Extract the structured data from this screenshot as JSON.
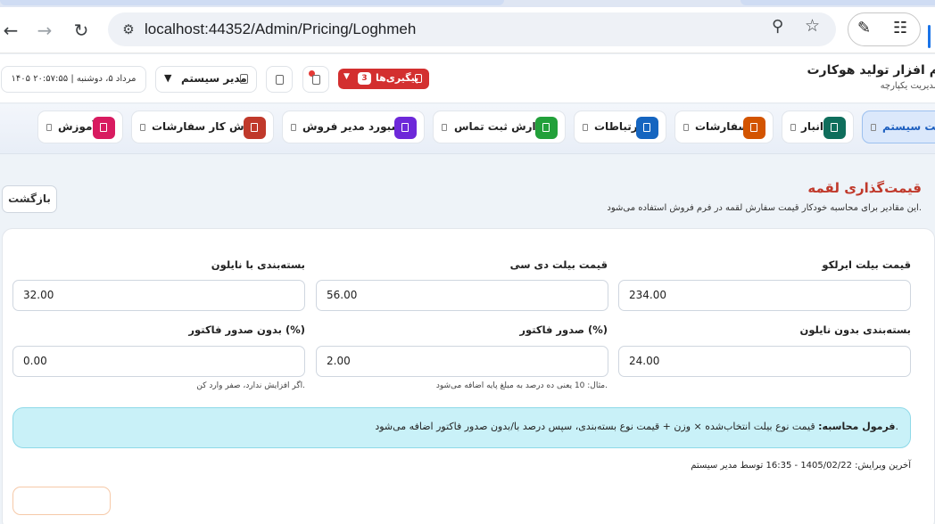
{
  "browser": {
    "url": "localhost:44352/Admin/Pricing/Loghmeh"
  },
  "header": {
    "brand_title": "م افزار تولید هوکارت",
    "brand_subtitle": "مدیریت یکپارچه",
    "datetime": "۱۴۰۵ مرداد ۵، دوشنبه   |   ۲۰:۵۷:۵۵",
    "user_name": "مدیر سیستم",
    "followups_label": "پیگیری‌ها",
    "followups_count": "3",
    "colors": {
      "followups": "#d32f2f"
    }
  },
  "modules": [
    {
      "label": "ریت سیستم",
      "color": "#1d5fbf",
      "active": true
    },
    {
      "label": "انبار",
      "color": "#0f6e5c"
    },
    {
      "label": "سفارشات",
      "color": "#d35400"
    },
    {
      "label": "ارتباطات",
      "color": "#1565c0"
    },
    {
      "label": "گزارش ثبت تماس",
      "color": "#22a03a"
    },
    {
      "label": "داشبورد مدیر فروش",
      "color": "#6d28d9"
    },
    {
      "label": "گردش کار سفارشات",
      "color": "#c0392b"
    },
    {
      "label": "آموزش",
      "color": "#d81b60"
    }
  ],
  "page": {
    "title": "قیمت‌گذاری لقمه",
    "description": "این مقادیر برای محاسبه خودکار قیمت سفارش لقمه در فرم فروش استفاده می‌شود.",
    "back_label": "بازگشت"
  },
  "form": {
    "airliko_label": "قیمت بیلت ایرلکو",
    "airliko_value": "234.00",
    "dc_label": "قیمت بیلت دی سی",
    "dc_value": "56.00",
    "nylon_label": "بسته‌بندی با نایلون",
    "nylon_value": "32.00",
    "no_nylon_label": "بسته‌بندی بدون نایلون",
    "no_nylon_value": "24.00",
    "invoice_label": "صدور فاکتور (%)",
    "invoice_value": "2.00",
    "invoice_hint": "مثال: 10 یعنی ده درصد به مبلغ پایه اضافه می‌شود.",
    "no_invoice_label": "بدون صدور فاکتور (%)",
    "no_invoice_value": "0.00",
    "no_invoice_hint": "اگر افزایش ندارد، صفر وارد کن."
  },
  "formula": {
    "bold": "فرمول محاسبه:",
    "text": "قیمت نوع بیلت انتخاب‌شده × وزن + قیمت نوع بسته‌بندی، سپس درصد با/بدون صدور فاکتور اضافه می‌شود."
  },
  "last_edit": "آخرین ویرایش: 1405/02/22 - 16:35 توسط مدیر سیستم"
}
